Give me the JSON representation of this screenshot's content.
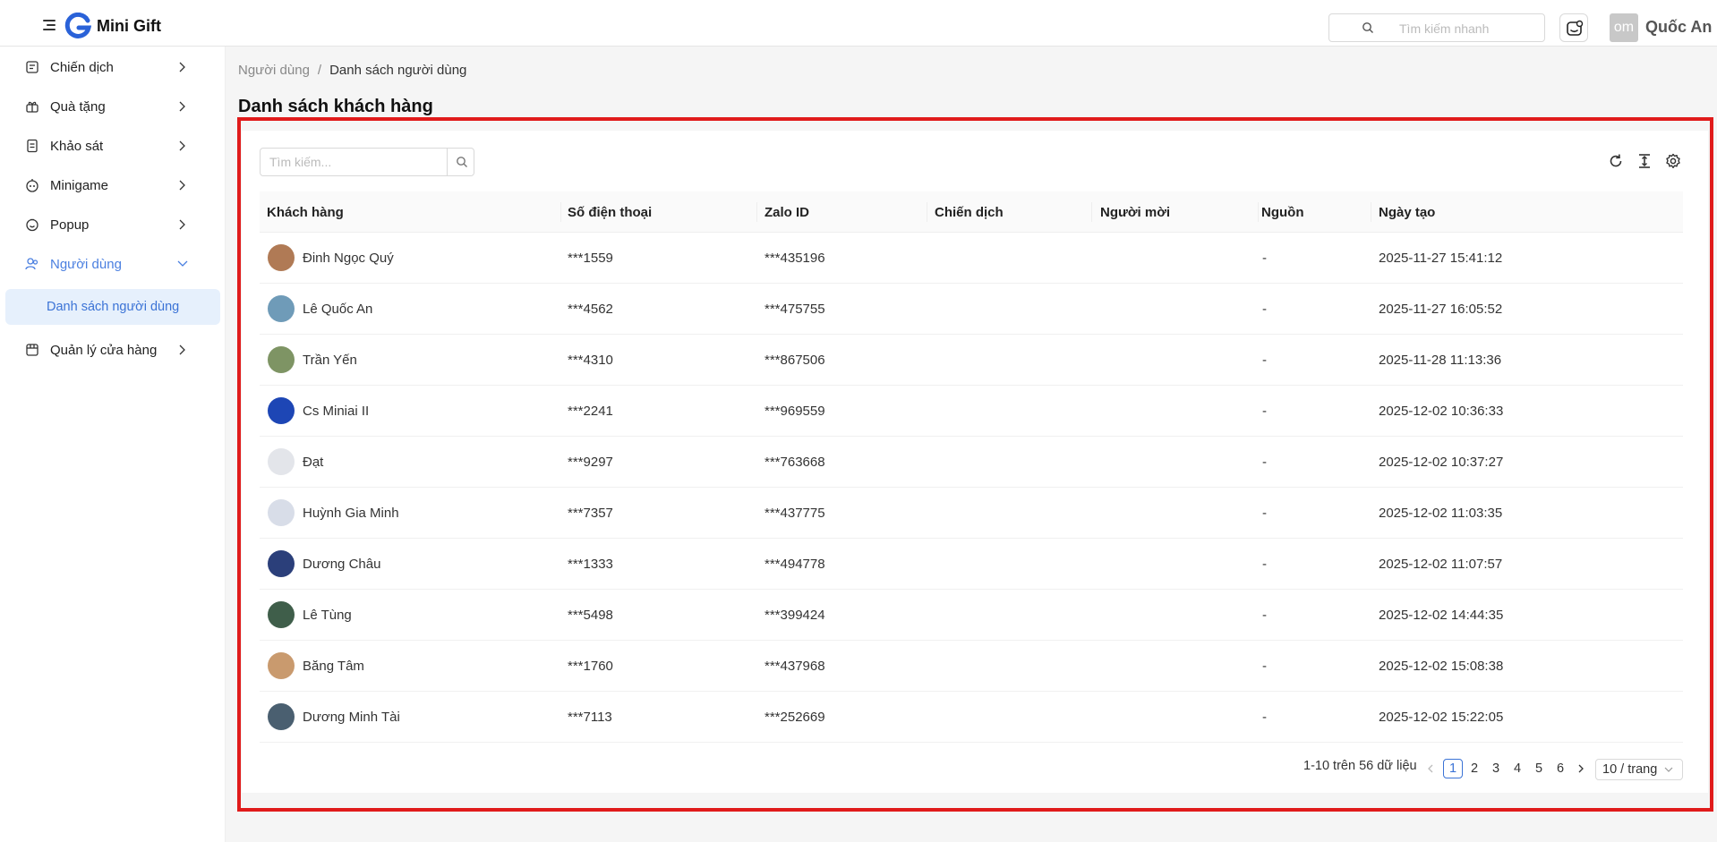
{
  "header": {
    "brand": "Mini Gift",
    "search_placeholder": "Tìm kiếm nhanh",
    "user_avatar_text": "om",
    "user_name": "Quốc An"
  },
  "sidebar": {
    "items": [
      {
        "label": "Chiến dịch",
        "icon": "campaign-icon"
      },
      {
        "label": "Quà tặng",
        "icon": "gift-icon"
      },
      {
        "label": "Khảo sát",
        "icon": "survey-icon"
      },
      {
        "label": "Minigame",
        "icon": "game-icon"
      },
      {
        "label": "Popup",
        "icon": "popup-icon"
      },
      {
        "label": "Người dùng",
        "icon": "users-icon",
        "expanded": true
      },
      {
        "label": "Quản lý cửa hàng",
        "icon": "store-icon"
      }
    ],
    "sub_item": "Danh sách người dùng",
    "active_color": "#4a7fe0"
  },
  "breadcrumb": {
    "parent": "Người dùng",
    "separator": "/",
    "current": "Danh sách người dùng"
  },
  "page_title": "Danh sách khách hàng",
  "table": {
    "search_placeholder": "Tìm kiếm...",
    "columns": [
      "Khách hàng",
      "Số điện thoại",
      "Zalo ID",
      "Chiến dịch",
      "Người mời",
      "Nguồn",
      "Ngày tạo"
    ],
    "rows": [
      {
        "name": "Đinh Ngọc Quý",
        "phone": "***1559",
        "zalo": "***435196",
        "campaign": "",
        "inviter": "",
        "source": "-",
        "created": "2025-11-27 15:41:12",
        "avatar": "#b07a55"
      },
      {
        "name": "Lê Quốc An",
        "phone": "***4562",
        "zalo": "***475755",
        "campaign": "",
        "inviter": "",
        "source": "-",
        "created": "2025-11-27 16:05:52",
        "avatar": "#6f9bb8"
      },
      {
        "name": "Trần Yến",
        "phone": "***4310",
        "zalo": "***867506",
        "campaign": "",
        "inviter": "",
        "source": "-",
        "created": "2025-11-28 11:13:36",
        "avatar": "#7e9464"
      },
      {
        "name": "Cs Miniai II",
        "phone": "***2241",
        "zalo": "***969559",
        "campaign": "",
        "inviter": "",
        "source": "-",
        "created": "2025-12-02 10:36:33",
        "avatar": "#1d46b5"
      },
      {
        "name": "Đạt",
        "phone": "***9297",
        "zalo": "***763668",
        "campaign": "",
        "inviter": "",
        "source": "-",
        "created": "2025-12-02 10:37:27",
        "avatar": "#e3e5ea"
      },
      {
        "name": "Huỳnh Gia Minh",
        "phone": "***7357",
        "zalo": "***437775",
        "campaign": "",
        "inviter": "",
        "source": "-",
        "created": "2025-12-02 11:03:35",
        "avatar": "#d8dde8"
      },
      {
        "name": "Dương Châu",
        "phone": "***1333",
        "zalo": "***494778",
        "campaign": "",
        "inviter": "",
        "source": "-",
        "created": "2025-12-02 11:07:57",
        "avatar": "#2b3f7a"
      },
      {
        "name": "Lê Tùng",
        "phone": "***5498",
        "zalo": "***399424",
        "campaign": "",
        "inviter": "",
        "source": "-",
        "created": "2025-12-02 14:44:35",
        "avatar": "#3f5e4a"
      },
      {
        "name": "Băng Tâm",
        "phone": "***1760",
        "zalo": "***437968",
        "campaign": "",
        "inviter": "",
        "source": "-",
        "created": "2025-12-02 15:08:38",
        "avatar": "#c99a6e"
      },
      {
        "name": "Dương Minh Tài",
        "phone": "***7113",
        "zalo": "***252669",
        "campaign": "",
        "inviter": "",
        "source": "-",
        "created": "2025-12-02 15:22:05",
        "avatar": "#4a5f70"
      }
    ]
  },
  "pagination": {
    "summary": "1-10 trên 56 dữ liệu",
    "pages": [
      "1",
      "2",
      "3",
      "4",
      "5",
      "6"
    ],
    "current": "1",
    "page_size": "10 / trang"
  }
}
